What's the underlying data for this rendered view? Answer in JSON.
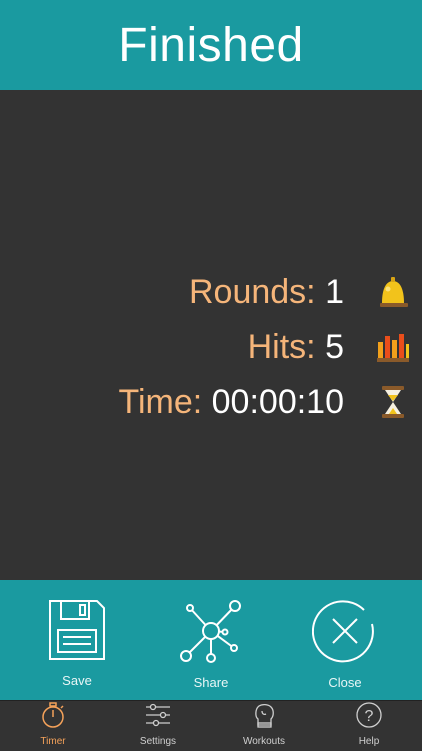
{
  "header": {
    "title": "Finished"
  },
  "stats": {
    "rounds": {
      "label": "Rounds:",
      "value": "1",
      "icon": "bell-icon"
    },
    "hits": {
      "label": "Hits:",
      "value": "5",
      "icon": "bars-icon"
    },
    "time": {
      "label": "Time:",
      "value": "00:00:10",
      "icon": "hourglass-icon"
    }
  },
  "actions": {
    "save_label": "Save",
    "share_label": "Share",
    "close_label": "Close"
  },
  "tabs": [
    {
      "label": "Timer",
      "icon": "stopwatch-icon",
      "active": true
    },
    {
      "label": "Settings",
      "icon": "sliders-icon",
      "active": false
    },
    {
      "label": "Workouts",
      "icon": "boxing-glove-icon",
      "active": false
    },
    {
      "label": "Help",
      "icon": "help-icon",
      "active": false
    }
  ],
  "colors": {
    "header_bg": "#1a9aa0",
    "main_bg": "#333333",
    "label_color": "#f5b57a",
    "active_tab": "#f5a25a"
  }
}
